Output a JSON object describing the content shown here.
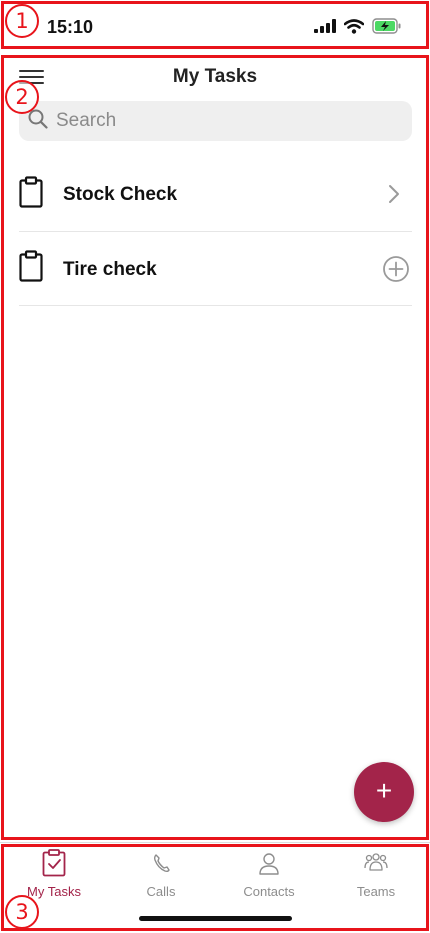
{
  "status_bar": {
    "time": "15:10",
    "icons": [
      "signal-icon",
      "wifi-icon",
      "battery-charging-icon"
    ]
  },
  "header": {
    "title": "My Tasks",
    "menu_icon": "hamburger-menu-icon"
  },
  "search": {
    "placeholder": "Search",
    "value": ""
  },
  "tasks": [
    {
      "label": "Stock Check",
      "icon": "clipboard-icon",
      "action": "chevron-right-icon"
    },
    {
      "label": "Tire check",
      "icon": "clipboard-icon",
      "action": "add-circle-icon"
    }
  ],
  "fab": {
    "label": "+"
  },
  "tabs": [
    {
      "label": "My Tasks",
      "icon": "clipboard-check-icon",
      "active": true
    },
    {
      "label": "Calls",
      "icon": "phone-icon",
      "active": false
    },
    {
      "label": "Contacts",
      "icon": "person-icon",
      "active": false
    },
    {
      "label": "Teams",
      "icon": "people-icon",
      "active": false
    }
  ],
  "annotations": [
    "1",
    "2",
    "3"
  ],
  "colors": {
    "accent": "#a3244a",
    "inactive": "#8d8d8d",
    "annotation": "#e8141b",
    "battery_green": "#4cd964"
  }
}
